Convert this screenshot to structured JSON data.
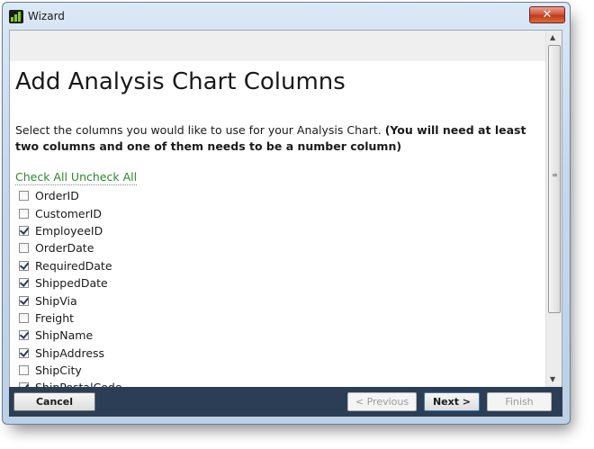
{
  "window": {
    "title": "Wizard",
    "close_glyph": "✕",
    "app_icon": "bar-chart-icon"
  },
  "page": {
    "title": "Add Analysis Chart Columns",
    "instruction": "Select the columns you would like to use for your Analysis Chart. ",
    "instruction_bold": "(You will need at least two columns and one of them needs to be a number column)"
  },
  "links": {
    "check_all": "Check All",
    "uncheck_all": "Uncheck All",
    "color": "#2a8a2a"
  },
  "columns": [
    {
      "label": "OrderID",
      "checked": false
    },
    {
      "label": "CustomerID",
      "checked": false
    },
    {
      "label": "EmployeeID",
      "checked": true
    },
    {
      "label": "OrderDate",
      "checked": false
    },
    {
      "label": "RequiredDate",
      "checked": true
    },
    {
      "label": "ShippedDate",
      "checked": true
    },
    {
      "label": "ShipVia",
      "checked": true
    },
    {
      "label": "Freight",
      "checked": false
    },
    {
      "label": "ShipName",
      "checked": true
    },
    {
      "label": "ShipAddress",
      "checked": true
    },
    {
      "label": "ShipCity",
      "checked": false
    },
    {
      "label": "ShipPostalCode",
      "checked": true
    }
  ],
  "footer": {
    "cancel": "Cancel",
    "previous": "< Previous",
    "next": "Next >",
    "finish": "Finish",
    "background": "#2c3e55"
  },
  "scrollbar": {
    "up_glyph": "▲",
    "down_glyph": "▼"
  }
}
